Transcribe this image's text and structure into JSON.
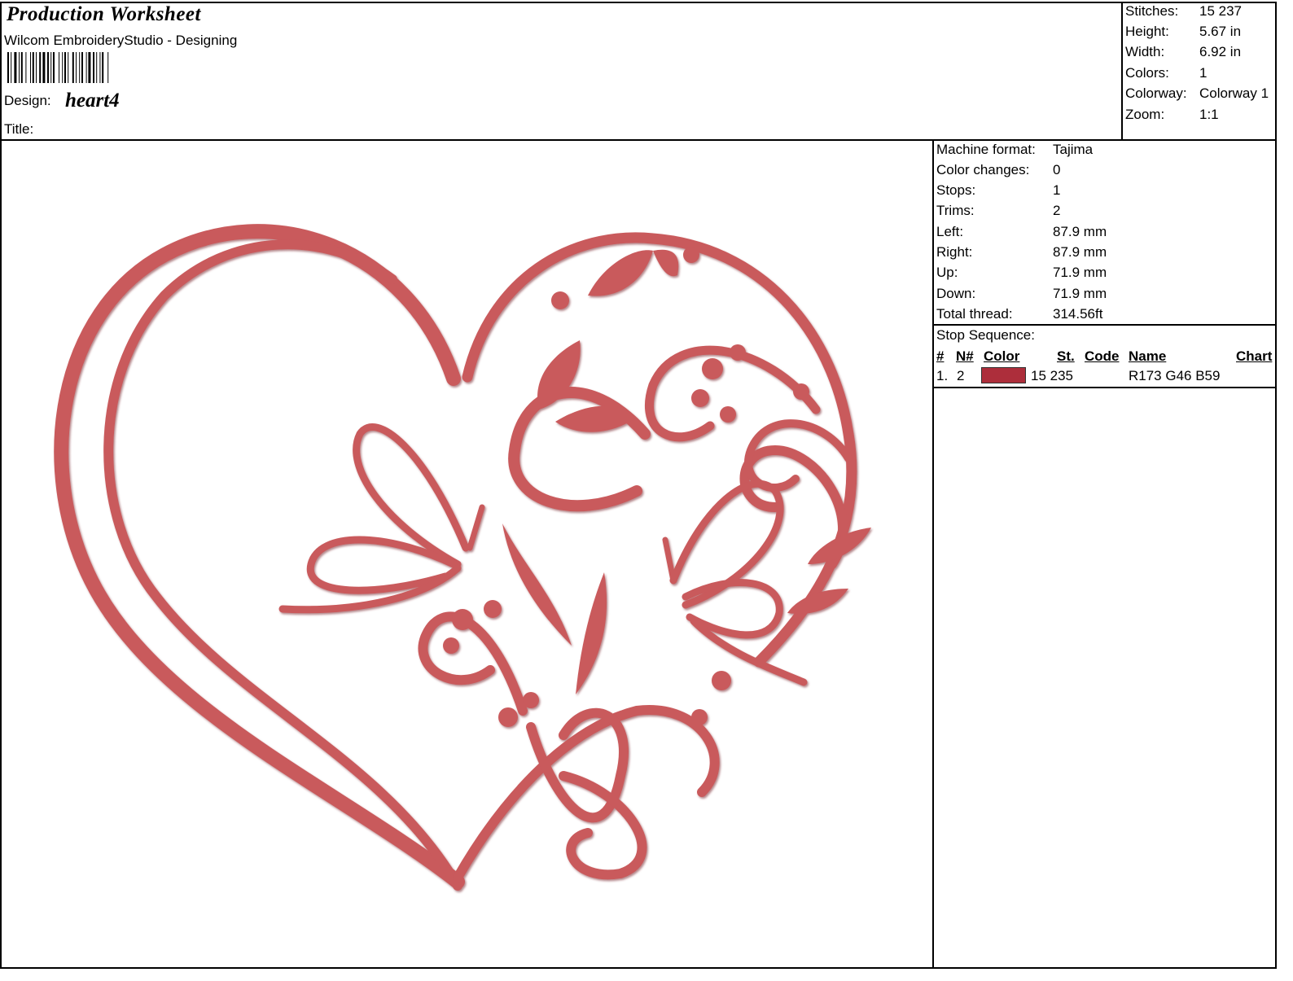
{
  "header": {
    "worksheet_title": "Production Worksheet",
    "app_name": "Wilcom EmbroideryStudio - Designing",
    "design_label": "Design:",
    "design_name": "heart4",
    "title_label": "Title:"
  },
  "stats": {
    "stitches_label": "Stitches:",
    "stitches": "15 237",
    "height_label": "Height:",
    "height": "5.67 in",
    "width_label": "Width:",
    "width": "6.92 in",
    "colors_label": "Colors:",
    "colors": "1",
    "colorway_label": "Colorway:",
    "colorway": "Colorway 1",
    "zoom_label": "Zoom:",
    "zoom": "1:1"
  },
  "machine": {
    "format_label": "Machine format:",
    "format": "Tajima",
    "color_changes_label": "Color changes:",
    "color_changes": "0",
    "stops_label": "Stops:",
    "stops": "1",
    "trims_label": "Trims:",
    "trims": "2",
    "left_label": "Left:",
    "left": "87.9 mm",
    "right_label": "Right:",
    "right": "87.9 mm",
    "up_label": "Up:",
    "up": "71.9 mm",
    "down_label": "Down:",
    "down": "71.9 mm",
    "total_thread_label": "Total thread:",
    "total_thread": "314.56ft"
  },
  "stop_sequence": {
    "title": "Stop Sequence:",
    "columns": [
      "#",
      "N#",
      "Color",
      "St.",
      "Code",
      "Name",
      "Chart"
    ],
    "rows": [
      {
        "index": "1.",
        "needle": "2",
        "color_hex": "#ad2e3b",
        "stitches": "15 235",
        "code": "",
        "name": "R173 G46 B59",
        "chart": ""
      }
    ]
  },
  "design": {
    "thread_color": "#c95a5c",
    "thread_shadow": "#a23c40"
  }
}
